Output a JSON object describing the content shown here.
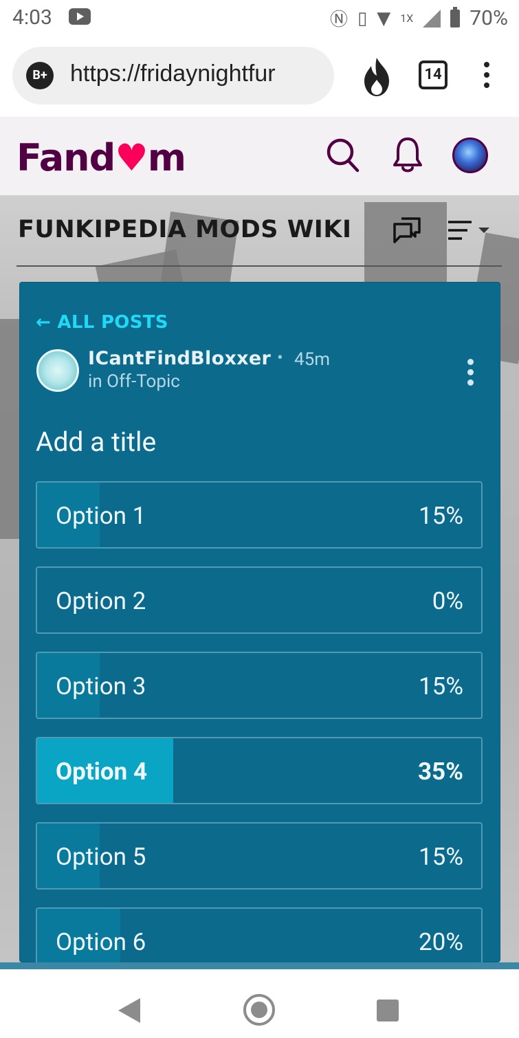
{
  "status_bar": {
    "time": "4:03",
    "battery": "70%",
    "icons": [
      "youtube-icon",
      "nfc-icon",
      "vibrate-icon",
      "wifi-icon",
      "signal-icon",
      "battery-icon"
    ],
    "extra": "1X"
  },
  "browser": {
    "url": "https://fridaynightfur",
    "profile_badge": "B+",
    "tab_count": "14"
  },
  "fandom": {
    "logo_text_left": "Fand",
    "logo_text_right": "m"
  },
  "wiki": {
    "title": "FUNKIPEDIA MODS WIKI"
  },
  "post": {
    "back_label": "← ALL POSTS",
    "author": "ICantFindBloxxer",
    "separator": "•",
    "time_ago": "45m",
    "category": "in Off-Topic",
    "poll_title": "Add a title",
    "options": [
      {
        "label": "Option 1",
        "percent": "15%",
        "value": 15,
        "winner": false
      },
      {
        "label": "Option 2",
        "percent": "0%",
        "value": 0,
        "winner": false
      },
      {
        "label": "Option 3",
        "percent": "15%",
        "value": 15,
        "winner": false
      },
      {
        "label": "Option 4",
        "percent": "35%",
        "value": 35,
        "winner": true
      },
      {
        "label": "Option 5",
        "percent": "15%",
        "value": 15,
        "winner": false
      },
      {
        "label": "Option 6",
        "percent": "20%",
        "value": 20,
        "winner": false
      }
    ]
  },
  "colors": {
    "card": "#0c6a8c",
    "accent": "#20d9f6",
    "fandom_brand": "#520044",
    "winner_fill": "#0aa5c4"
  }
}
